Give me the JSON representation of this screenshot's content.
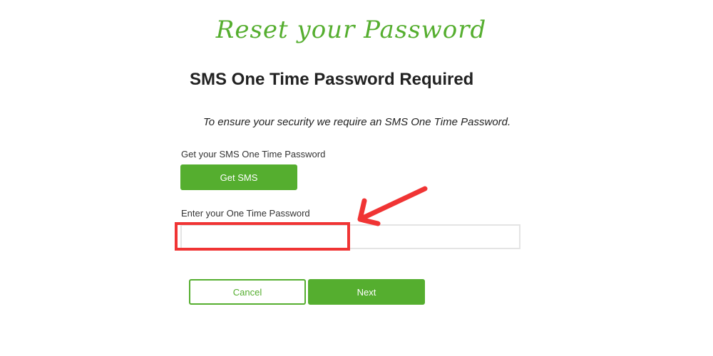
{
  "header": {
    "script_title": "Reset your Password",
    "heading": "SMS One Time Password Required",
    "subtitle": "To ensure your security we require an SMS One Time Password."
  },
  "sms": {
    "label": "Get your SMS One Time Password",
    "button_label": "Get SMS"
  },
  "otp": {
    "label": "Enter your One Time Password",
    "value": "",
    "placeholder": ""
  },
  "actions": {
    "cancel_label": "Cancel",
    "next_label": "Next"
  },
  "colors": {
    "accent": "#55ae2f",
    "annotation": "#f03434",
    "text": "#222222"
  },
  "annotation": {
    "icon": "arrow-icon"
  }
}
